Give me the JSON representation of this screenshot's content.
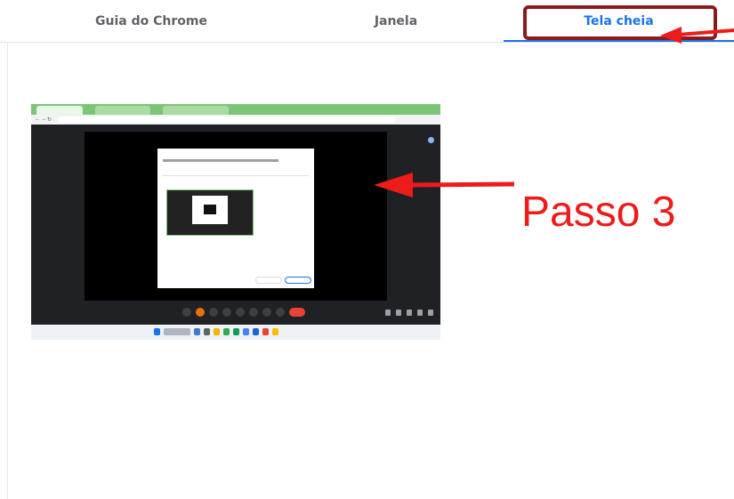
{
  "tabs": {
    "items": [
      {
        "label": "Guia do Chrome"
      },
      {
        "label": "Janela"
      },
      {
        "label": "Tela cheia"
      }
    ],
    "selected_index": 2
  },
  "annotation": {
    "step_label": "Passo  3",
    "color": "#ee1b1b",
    "highlight_color": "#8b1a1a"
  },
  "colors": {
    "accent": "#1a73e8",
    "tab_inactive": "#5f6368"
  }
}
